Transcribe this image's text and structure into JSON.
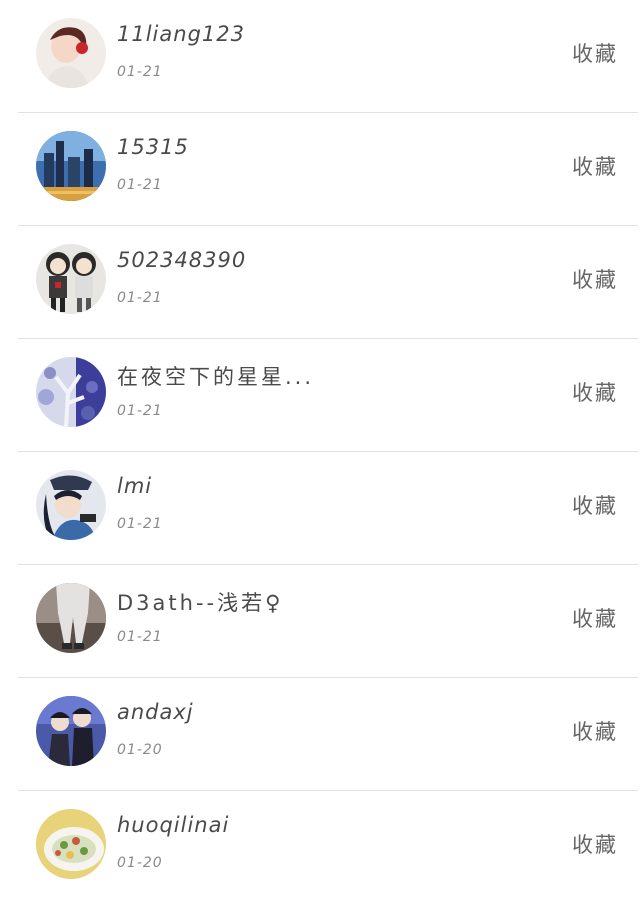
{
  "items": [
    {
      "name": "11liang123",
      "date": "01-21",
      "action": "收藏",
      "avatar_icon": "avatar-girl-portrait-icon"
    },
    {
      "name": "15315",
      "date": "01-21",
      "action": "收藏",
      "avatar_icon": "avatar-city-skyline-icon"
    },
    {
      "name": "502348390",
      "date": "01-21",
      "action": "收藏",
      "avatar_icon": "avatar-two-dolls-icon"
    },
    {
      "name": "在夜空下的星星...",
      "date": "01-21",
      "action": "收藏",
      "avatar_icon": "avatar-blue-tree-icon"
    },
    {
      "name": "lmi",
      "date": "01-21",
      "action": "收藏",
      "avatar_icon": "avatar-anime-girl-icon"
    },
    {
      "name": "D3ath--浅若♀",
      "date": "01-21",
      "action": "收藏",
      "avatar_icon": "avatar-figure-legs-icon"
    },
    {
      "name": "andaxj",
      "date": "01-20",
      "action": "收藏",
      "avatar_icon": "avatar-anime-couple-icon"
    },
    {
      "name": "huoqilinai",
      "date": "01-20",
      "action": "收藏",
      "avatar_icon": "avatar-food-plate-icon"
    }
  ]
}
